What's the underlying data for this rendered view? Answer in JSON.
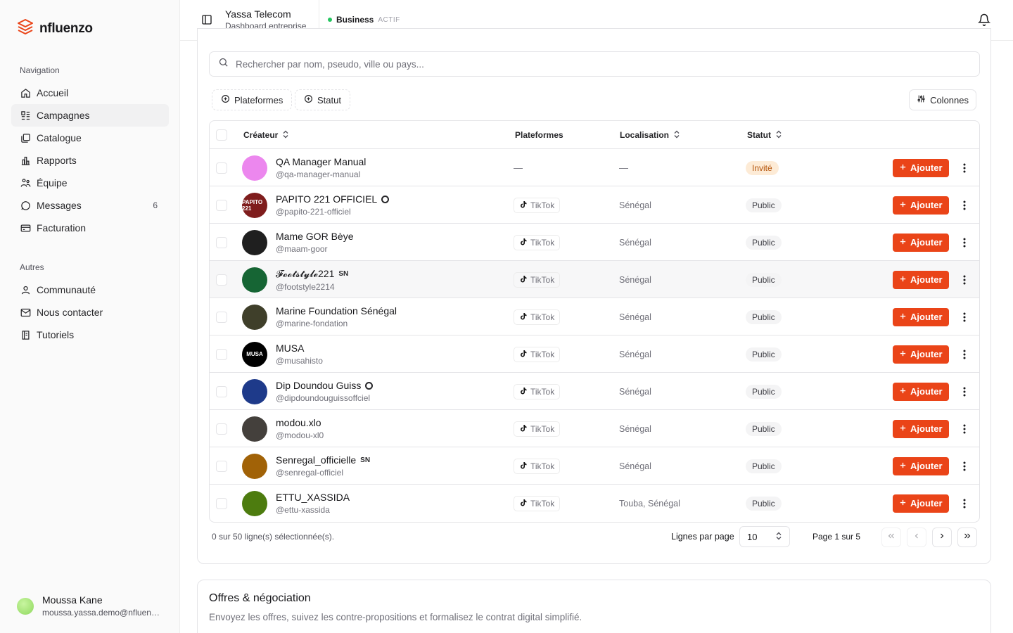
{
  "brand": {
    "name": "nfluenzo",
    "accent": "#ea4418"
  },
  "sidebar": {
    "nav_label": "Navigation",
    "nav_items": [
      {
        "label": "Accueil",
        "icon": "home-icon"
      },
      {
        "label": "Campagnes",
        "icon": "campaigns-icon",
        "active": true
      },
      {
        "label": "Catalogue",
        "icon": "catalog-icon"
      },
      {
        "label": "Rapports",
        "icon": "reports-icon"
      },
      {
        "label": "Équipe",
        "icon": "team-icon"
      },
      {
        "label": "Messages",
        "icon": "message-icon",
        "badge": "6"
      },
      {
        "label": "Facturation",
        "icon": "billing-icon"
      }
    ],
    "other_label": "Autres",
    "other_items": [
      {
        "label": "Communauté",
        "icon": "community-icon"
      },
      {
        "label": "Nous contacter",
        "icon": "mail-icon"
      },
      {
        "label": "Tutoriels",
        "icon": "book-icon"
      }
    ],
    "user": {
      "name": "Moussa Kane",
      "email": "moussa.yassa.demo@nfluenzo.com"
    }
  },
  "topbar": {
    "org_name": "Yassa Telecom",
    "org_sub": "Dashboard entreprise",
    "plan": "Business",
    "plan_status": "ACTIF"
  },
  "search": {
    "placeholder": "Rechercher par nom, pseudo, ville ou pays..."
  },
  "filters": {
    "platforms": "Plateformes",
    "status": "Statut",
    "columns": "Colonnes"
  },
  "table": {
    "headers": {
      "creator": "Créateur",
      "platforms": "Plateformes",
      "location": "Localisation",
      "status": "Statut"
    },
    "add_label": "Ajouter",
    "rows": [
      {
        "name": "QA Manager Manual",
        "handle": "@qa-manager-manual",
        "platform": "—",
        "location": "—",
        "status": "Invité",
        "avatar": "#ec87ee"
      },
      {
        "name": "PAPITO 221 OFFICIEL",
        "handle": "@papito-221-officiel",
        "platform": "TikTok",
        "location": "Sénégal",
        "status": "Public",
        "verified": true,
        "avatar": "#7f1d1d",
        "avatar_text": "PAPITO 221"
      },
      {
        "name": "Mame GOR Bèye",
        "handle": "@maam-goor",
        "platform": "TikTok",
        "location": "Sénégal",
        "status": "Public",
        "avatar": "#1f1f1f"
      },
      {
        "name": "𝓕𝓸𝓸𝓽𝓼𝓽𝔂𝓵𝓮221",
        "handle": "@footstyle2214",
        "platform": "TikTok",
        "location": "Sénégal",
        "status": "Public",
        "suffix": "SN",
        "avatar": "#166534"
      },
      {
        "name": "Marine Foundation Sénégal",
        "handle": "@marine-fondation",
        "platform": "TikTok",
        "location": "Sénégal",
        "status": "Public",
        "avatar": "#3f3f2a"
      },
      {
        "name": "MUSA",
        "handle": "@musahisto",
        "platform": "TikTok",
        "location": "Sénégal",
        "status": "Public",
        "avatar": "#000000",
        "avatar_text": "MUSA"
      },
      {
        "name": "Dip Doundou Guiss",
        "handle": "@dipdoundouguissoffciel",
        "platform": "TikTok",
        "location": "Sénégal",
        "status": "Public",
        "verified": true,
        "avatar": "#1e3a8a"
      },
      {
        "name": "modou.xlo",
        "handle": "@modou-xl0",
        "platform": "TikTok",
        "location": "Sénégal",
        "status": "Public",
        "avatar": "#44403c"
      },
      {
        "name": "Senregal_officielle",
        "handle": "@senregal-officiel",
        "platform": "TikTok",
        "location": "Sénégal",
        "status": "Public",
        "suffix": "SN",
        "avatar": "#a16207"
      },
      {
        "name": "ETTU_XASSIDA",
        "handle": "@ettu-xassida",
        "platform": "TikTok",
        "location": "Touba, Sénégal",
        "status": "Public",
        "avatar": "#4d7c0f"
      }
    ]
  },
  "pagination": {
    "selected": "0 sur 50 ligne(s) sélectionnée(s).",
    "rows_label": "Lignes par page",
    "rows_value": "10",
    "page_info": "Page 1 sur 5"
  },
  "offers": {
    "title": "Offres & négociation",
    "subtitle": "Envoyez les offres, suivez les contre-propositions et formalisez le contrat digital simplifié."
  }
}
